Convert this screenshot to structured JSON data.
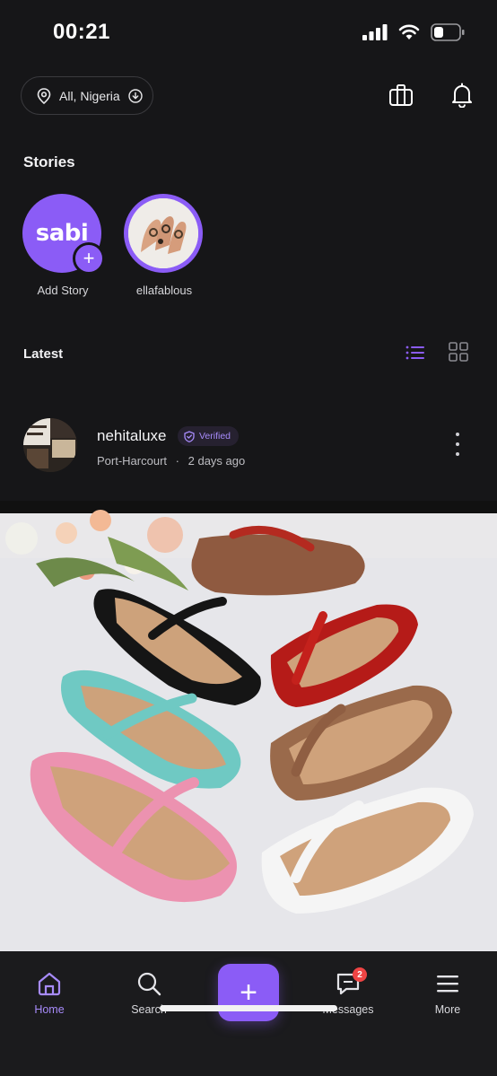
{
  "status_bar": {
    "time": "00:21"
  },
  "location": {
    "label": "All, Nigeria"
  },
  "stories": {
    "title": "Stories",
    "items": [
      {
        "label": "Add Story",
        "logo_text": "sabi"
      },
      {
        "label": "ellafablous"
      }
    ]
  },
  "latest": {
    "title": "Latest"
  },
  "post": {
    "username": "nehitaluxe",
    "verified_label": "Verified",
    "location": "Port-Harcourt",
    "separator": "·",
    "time_ago": "2 days ago"
  },
  "nav": {
    "items": [
      {
        "label": "Home",
        "icon": "home-icon",
        "active": true
      },
      {
        "label": "Search",
        "icon": "search-icon"
      },
      {
        "label": "Messages",
        "icon": "messages-icon",
        "badge": "2"
      },
      {
        "label": "More",
        "icon": "menu-icon"
      }
    ],
    "fab_icon": "plus-icon"
  },
  "colors": {
    "accent": "#8b5cf6",
    "background": "#161618",
    "badge": "#ef4444"
  }
}
